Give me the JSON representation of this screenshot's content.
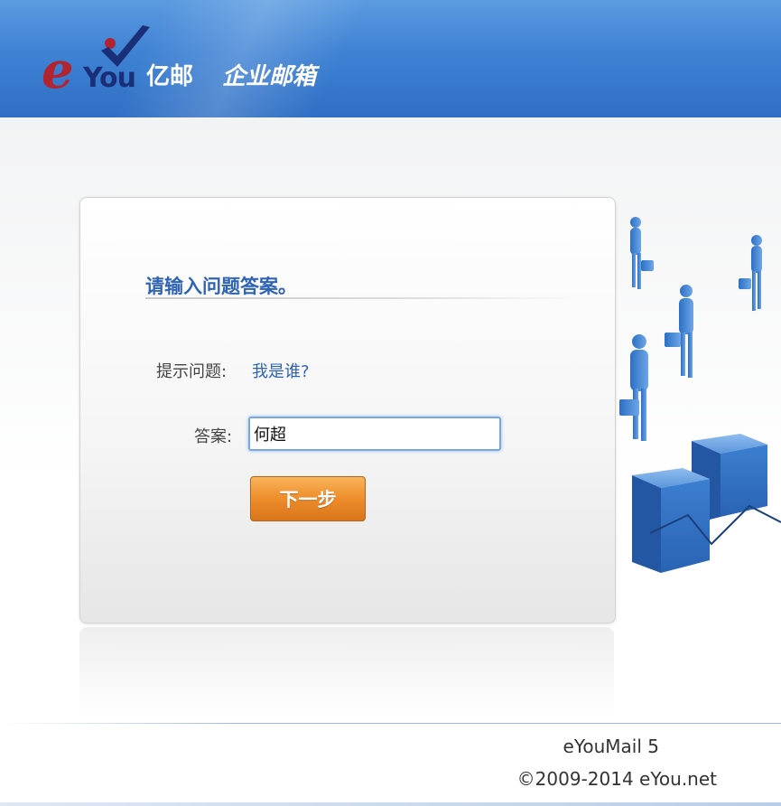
{
  "header": {
    "logo": {
      "e": "e",
      "you": "You",
      "cn": "亿邮"
    },
    "product_name": "企业邮箱",
    "colors": {
      "primary": "#3f82d4",
      "logo_red": "#b32431",
      "logo_navy": "#1a2f78"
    }
  },
  "form": {
    "title": "请输入问题答案。",
    "question_label": "提示问题:",
    "question_text": "我是谁?",
    "answer_label": "答案:",
    "answer_value": "何超",
    "next_button": "下一步",
    "accent_color": "#ee8d2c",
    "link_color": "#2f64b5"
  },
  "footer": {
    "product": "eYouMail 5",
    "copyright": "©2009-2014 eYou.net"
  }
}
